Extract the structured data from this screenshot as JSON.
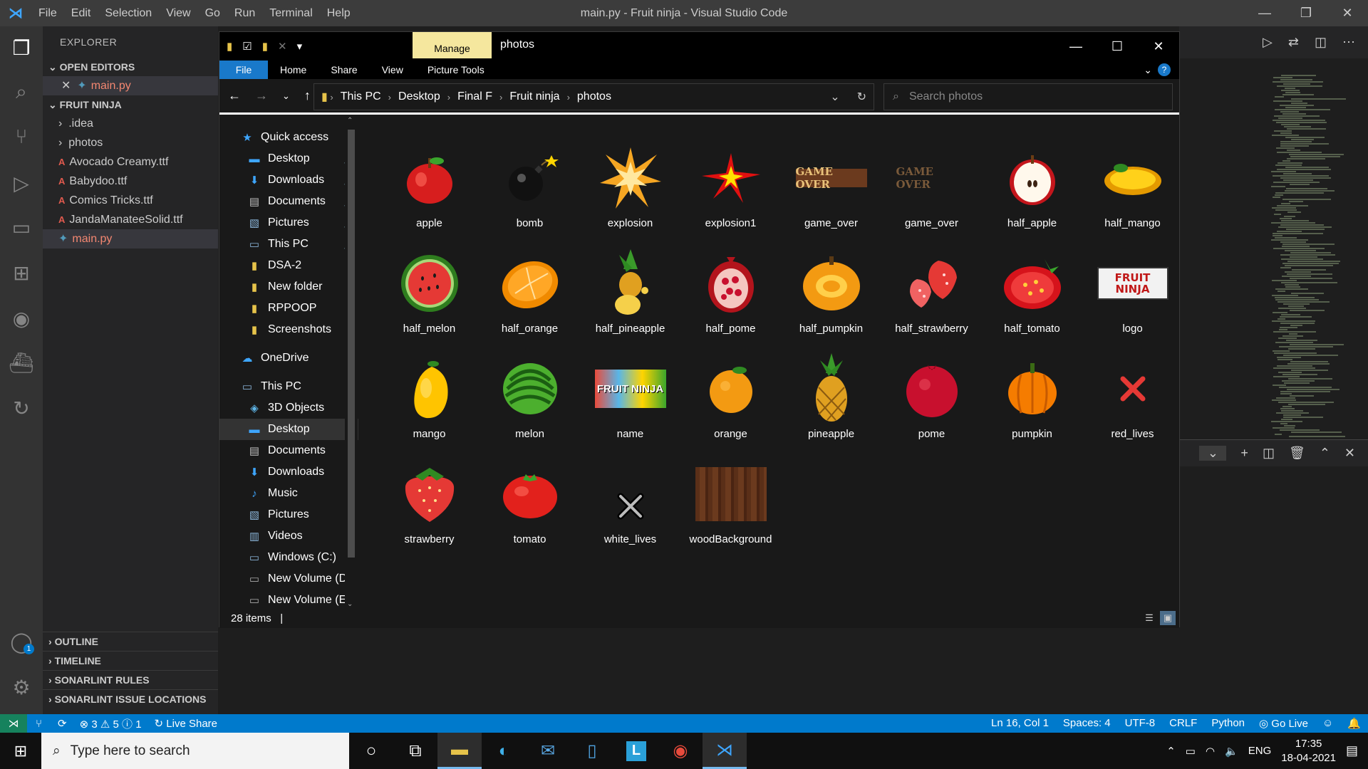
{
  "vscode": {
    "menu": [
      "File",
      "Edit",
      "Selection",
      "View",
      "Go",
      "Run",
      "Terminal",
      "Help"
    ],
    "window_title": "main.py - Fruit ninja - Visual Studio Code",
    "explorer_title": "EXPLORER",
    "open_editors": {
      "title": "OPEN EDITORS",
      "items": [
        {
          "name": "main.py"
        }
      ]
    },
    "folder": {
      "title": "FRUIT NINJA",
      "items": [
        ".idea",
        "photos",
        "Avocado Creamy.ttf",
        "Babydoo.ttf",
        "Comics Tricks.ttf",
        "JandaManateeSolid.ttf",
        "main.py"
      ]
    },
    "bottom_sections": [
      "OUTLINE",
      "TIMELINE",
      "SONARLINT RULES",
      "SONARLINT ISSUE LOCATIONS"
    ],
    "account_badge": "1"
  },
  "status_bar": {
    "errors": "3",
    "warnings": "5",
    "info": "1",
    "live_share": "Live Share",
    "position": "Ln 16, Col 1",
    "spaces": "Spaces: 4",
    "encoding": "UTF-8",
    "eol": "CRLF",
    "language": "Python",
    "go_live": "Go Live"
  },
  "explorer_window": {
    "manage_tab": "Manage",
    "title": "photos",
    "ribbon": [
      "File",
      "Home",
      "Share",
      "View",
      "Picture Tools"
    ],
    "breadcrumb": [
      "This PC",
      "Desktop",
      "Final F",
      "Fruit ninja",
      "photos"
    ],
    "search_placeholder": "Search photos",
    "nav": {
      "quick_access": "Quick access",
      "quick_items": [
        "Desktop",
        "Downloads",
        "Documents",
        "Pictures",
        "This PC",
        "DSA-2",
        "New folder",
        "RPPOOP",
        "Screenshots"
      ],
      "onedrive": "OneDrive",
      "this_pc": "This PC",
      "pc_items": [
        "3D Objects",
        "Desktop",
        "Documents",
        "Downloads",
        "Music",
        "Pictures",
        "Videos",
        "Windows (C:)",
        "New Volume (D:)",
        "New Volume (E:)"
      ]
    },
    "files": [
      "apple",
      "bomb",
      "explosion",
      "explosion1",
      "game_over",
      "game_over",
      "half_apple",
      "half_mango",
      "half_melon",
      "half_orange",
      "half_pineapple",
      "half_pome",
      "half_pumpkin",
      "half_strawberry",
      "half_tomato",
      "logo",
      "mango",
      "melon",
      "name",
      "orange",
      "pineapple",
      "pome",
      "pumpkin",
      "red_lives",
      "strawberry",
      "tomato",
      "white_lives",
      "woodBackground"
    ],
    "item_count": "28 items",
    "game_over_text": "GAME OVER",
    "logo_text": "FRUIT NINJA"
  },
  "taskbar": {
    "search_placeholder": "Type here to search",
    "lang": "ENG",
    "time": "17:35",
    "date": "18-04-2021"
  }
}
